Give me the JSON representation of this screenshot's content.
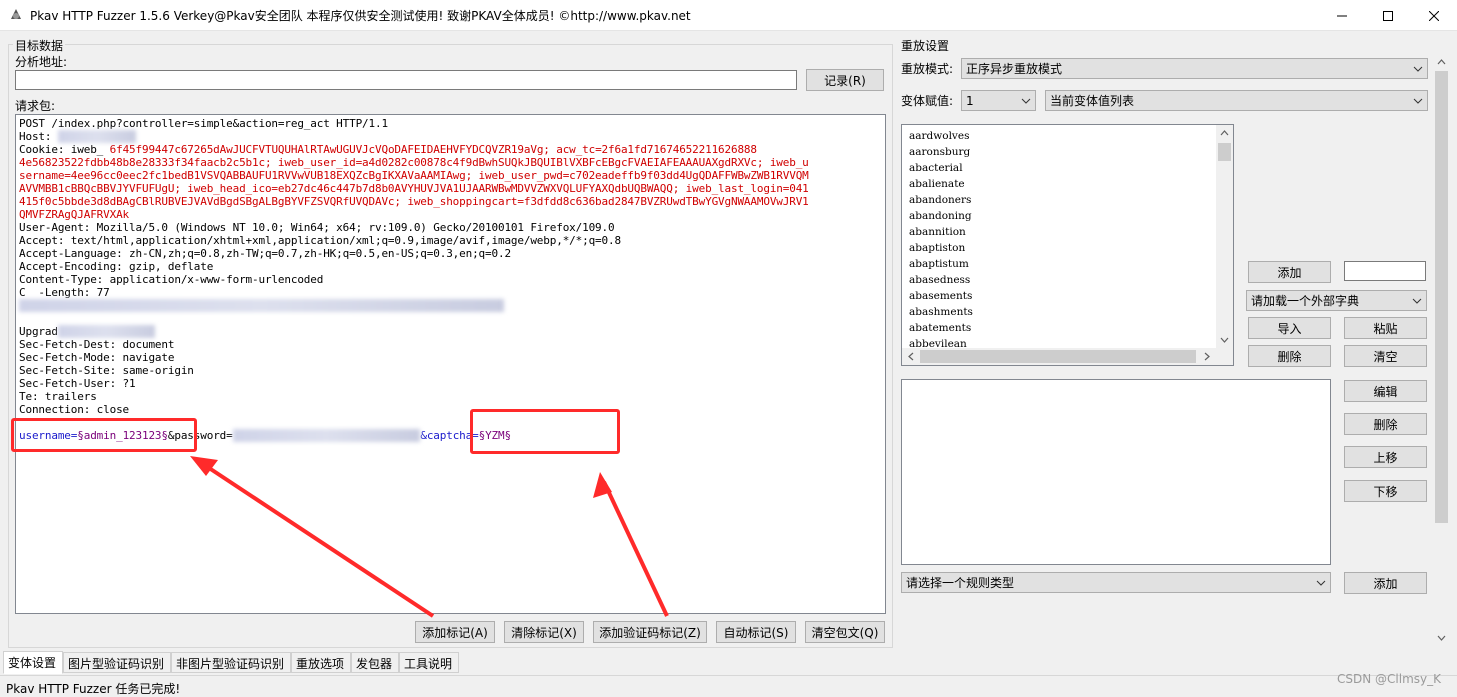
{
  "window": {
    "title": "Pkav HTTP Fuzzer 1.5.6  Verkey@Pkav安全团队  本程序仅供安全测试使用! 致谢PKAV全体成员! ©http://www.pkav.net"
  },
  "target": {
    "group_label": "目标数据",
    "analyze_label": "分析地址:",
    "analyze_value": "",
    "record_button": "记录(R)",
    "request_label": "请求包:",
    "request_lines": [
      "POST /index.php?controller=simple&action=reg_act HTTP/1.1",
      "Host: ",
      "Cookie: iweb_ ",
      "4e56823522fdbb48b8e28333f34faacb2c5b1c; iweb_user_id=a4d0282c00878c4f9dBwhSUQkJBQUIBlVXBFcEBgcFVAEIAFEAAAUAXgdRXVc; iweb_u",
      "sername=4ee96cc0eec2fc1bedB1VSVQABBAUFU1RVVwVUB18EXQZcBgIKXAVaAAMIAwg; iweb_user_pwd=c702eadeffb9f03dd4UgQDAFFWBwZWB1RVVQM",
      "AVVMBB1cBBQcBBVJYVFUFUgU; iweb_head_ico=eb27dc46c447b7d8b0AVYHUVJVA1UJAARWBwMDVVZWXVQLUFYAXQdbUQBWAQQ; iweb_last_login=041",
      "415f0c5bbde3d8dBAgCBlRUBVEJVAVdBgdSBgALBgBYVFZSVQRfUVQDAVc; iweb_shoppingcart=f3dfdd8c636bad2847BVZRUwdTBwYGVgNWAAMOVwJRV1",
      "QMVFZRAgQJAFRVXAk",
      "User-Agent: Mozilla/5.0 (Windows NT 10.0; Win64; x64; rv:109.0) Gecko/20100101 Firefox/109.0",
      "Accept: text/html,application/xhtml+xml,application/xml;q=0.9,image/avif,image/webp,*/*;q=0.8",
      "Accept-Language: zh-CN,zh;q=0.8,zh-TW;q=0.7,zh-HK;q=0.5,en-US;q=0.3,en;q=0.2",
      "Accept-Encoding: gzip, deflate",
      "Content-Type: application/x-www-form-urlencoded",
      "C  -Length: 77",
      "",
      "",
      "Upgrad",
      "Sec-Fetch-Dest: document",
      "Sec-Fetch-Mode: navigate",
      "Sec-Fetch-Site: same-origin",
      "Sec-Fetch-User: ?1",
      "Te: trailers",
      "Connection: close",
      ""
    ],
    "cookie_line_rest": "6f45f99447c67265dAwJUCFVTUQUHAlRTAwUGUVJcVQoDAFEIDAEHVFYDCQVZR19aVg; acw_tc=2f6a1fd71674652211626888",
    "body_username": "username=",
    "body_username_value": "§admin_123123§",
    "body_password": "&password=",
    "body_captcha": "&captcha=",
    "body_captcha_value": "§YZM§",
    "buttons": {
      "add_mark": "添加标记(A)",
      "clear_mark": "清除标记(X)",
      "add_captcha_mark": "添加验证码标记(Z)",
      "auto_mark": "自动标记(S)",
      "clear_packet": "清空包文(Q)"
    }
  },
  "replay": {
    "group_label": "重放设置",
    "mode_label": "重放模式:",
    "mode_value": "正序异步重放模式",
    "var_label": "变体赋值:",
    "var_index": "1",
    "var_list": "当前变体值列表",
    "words": [
      "aardwolves",
      "aaronsburg",
      "abacterial",
      "abalienate",
      "abandoners",
      "abandoning",
      "abannition",
      "abaptiston",
      "abaptistum",
      "abasedness",
      "abasements",
      "abashments",
      "abatements",
      "abbevilean"
    ],
    "add_button": "添加",
    "add_input_value": "",
    "dict_select": "请加载一个外部字典",
    "import_button": "导入",
    "paste_button": "粘贴",
    "delete_button": "删除",
    "clear_button": "清空",
    "edit_button": "编辑",
    "delete_button2": "删除",
    "move_up_button": "上移",
    "move_down_button": "下移",
    "rule_select": "请选择一个规则类型",
    "rule_add_button": "添加"
  },
  "tabs": [
    "变体设置",
    "图片型验证码识别",
    "非图片型验证码识别",
    "重放选项",
    "发包器",
    "工具说明"
  ],
  "status": "Pkav HTTP Fuzzer 任务已完成!",
  "watermark": "CSDN @Cllmsy_K",
  "colors": {
    "annotation": "#ff2a2a",
    "param_name": "#1a1acc",
    "cookie_value": "#d00000",
    "marker": "#7a007a"
  }
}
